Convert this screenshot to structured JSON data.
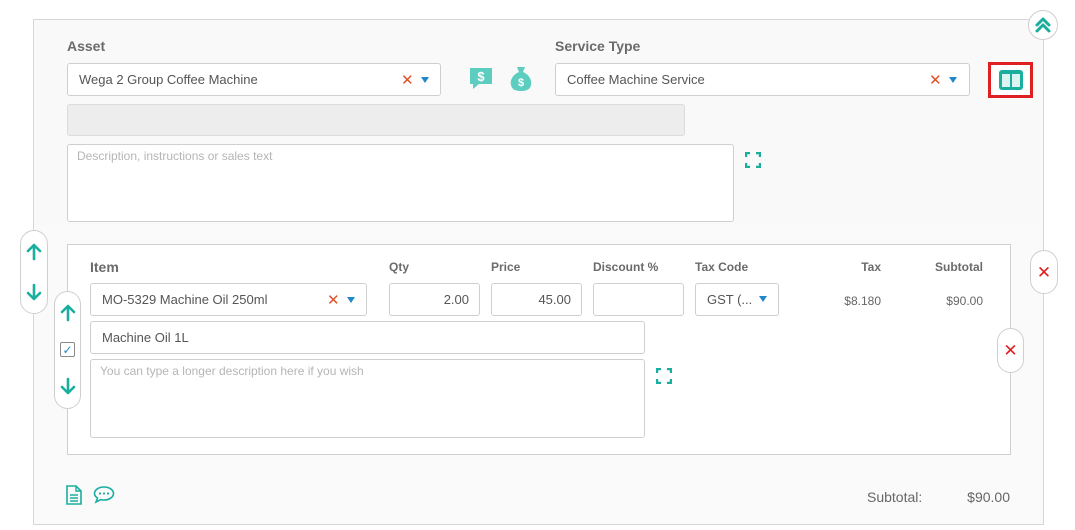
{
  "asset": {
    "label": "Asset",
    "value": "Wega 2 Group Coffee Machine",
    "clear_glyph": "✕"
  },
  "service_type": {
    "label": "Service Type",
    "value": "Coffee Machine Service",
    "clear_glyph": "✕"
  },
  "description": {
    "placeholder": "Description, instructions or sales text"
  },
  "line_item": {
    "headers": {
      "item": "Item",
      "qty": "Qty",
      "price": "Price",
      "discount": "Discount %",
      "tax_code": "Tax Code",
      "tax": "Tax",
      "subtotal": "Subtotal"
    },
    "item_value": "MO-5329 Machine Oil 250ml",
    "clear_glyph": "✕",
    "qty": "2.00",
    "price": "45.00",
    "discount": "",
    "tax_code": "GST (...",
    "tax": "$8.180",
    "subtotal": "$90.00",
    "short_description": "Machine Oil 1L",
    "long_description_placeholder": "You can type a longer description here if you wish",
    "checkbox_checked": true,
    "check_glyph": "✓"
  },
  "footer": {
    "subtotal_label": "Subtotal:",
    "subtotal_value": "$90.00"
  },
  "icons": {
    "arrow_up": "🡑",
    "arrow_down": "🡓",
    "remove_glyph": "✕"
  },
  "colors": {
    "accent_teal": "#1aae9f",
    "clear_red": "#e0522a",
    "remove_red": "#e02020",
    "caret_blue": "#1e88c8",
    "highlight_red": "#e02020"
  }
}
